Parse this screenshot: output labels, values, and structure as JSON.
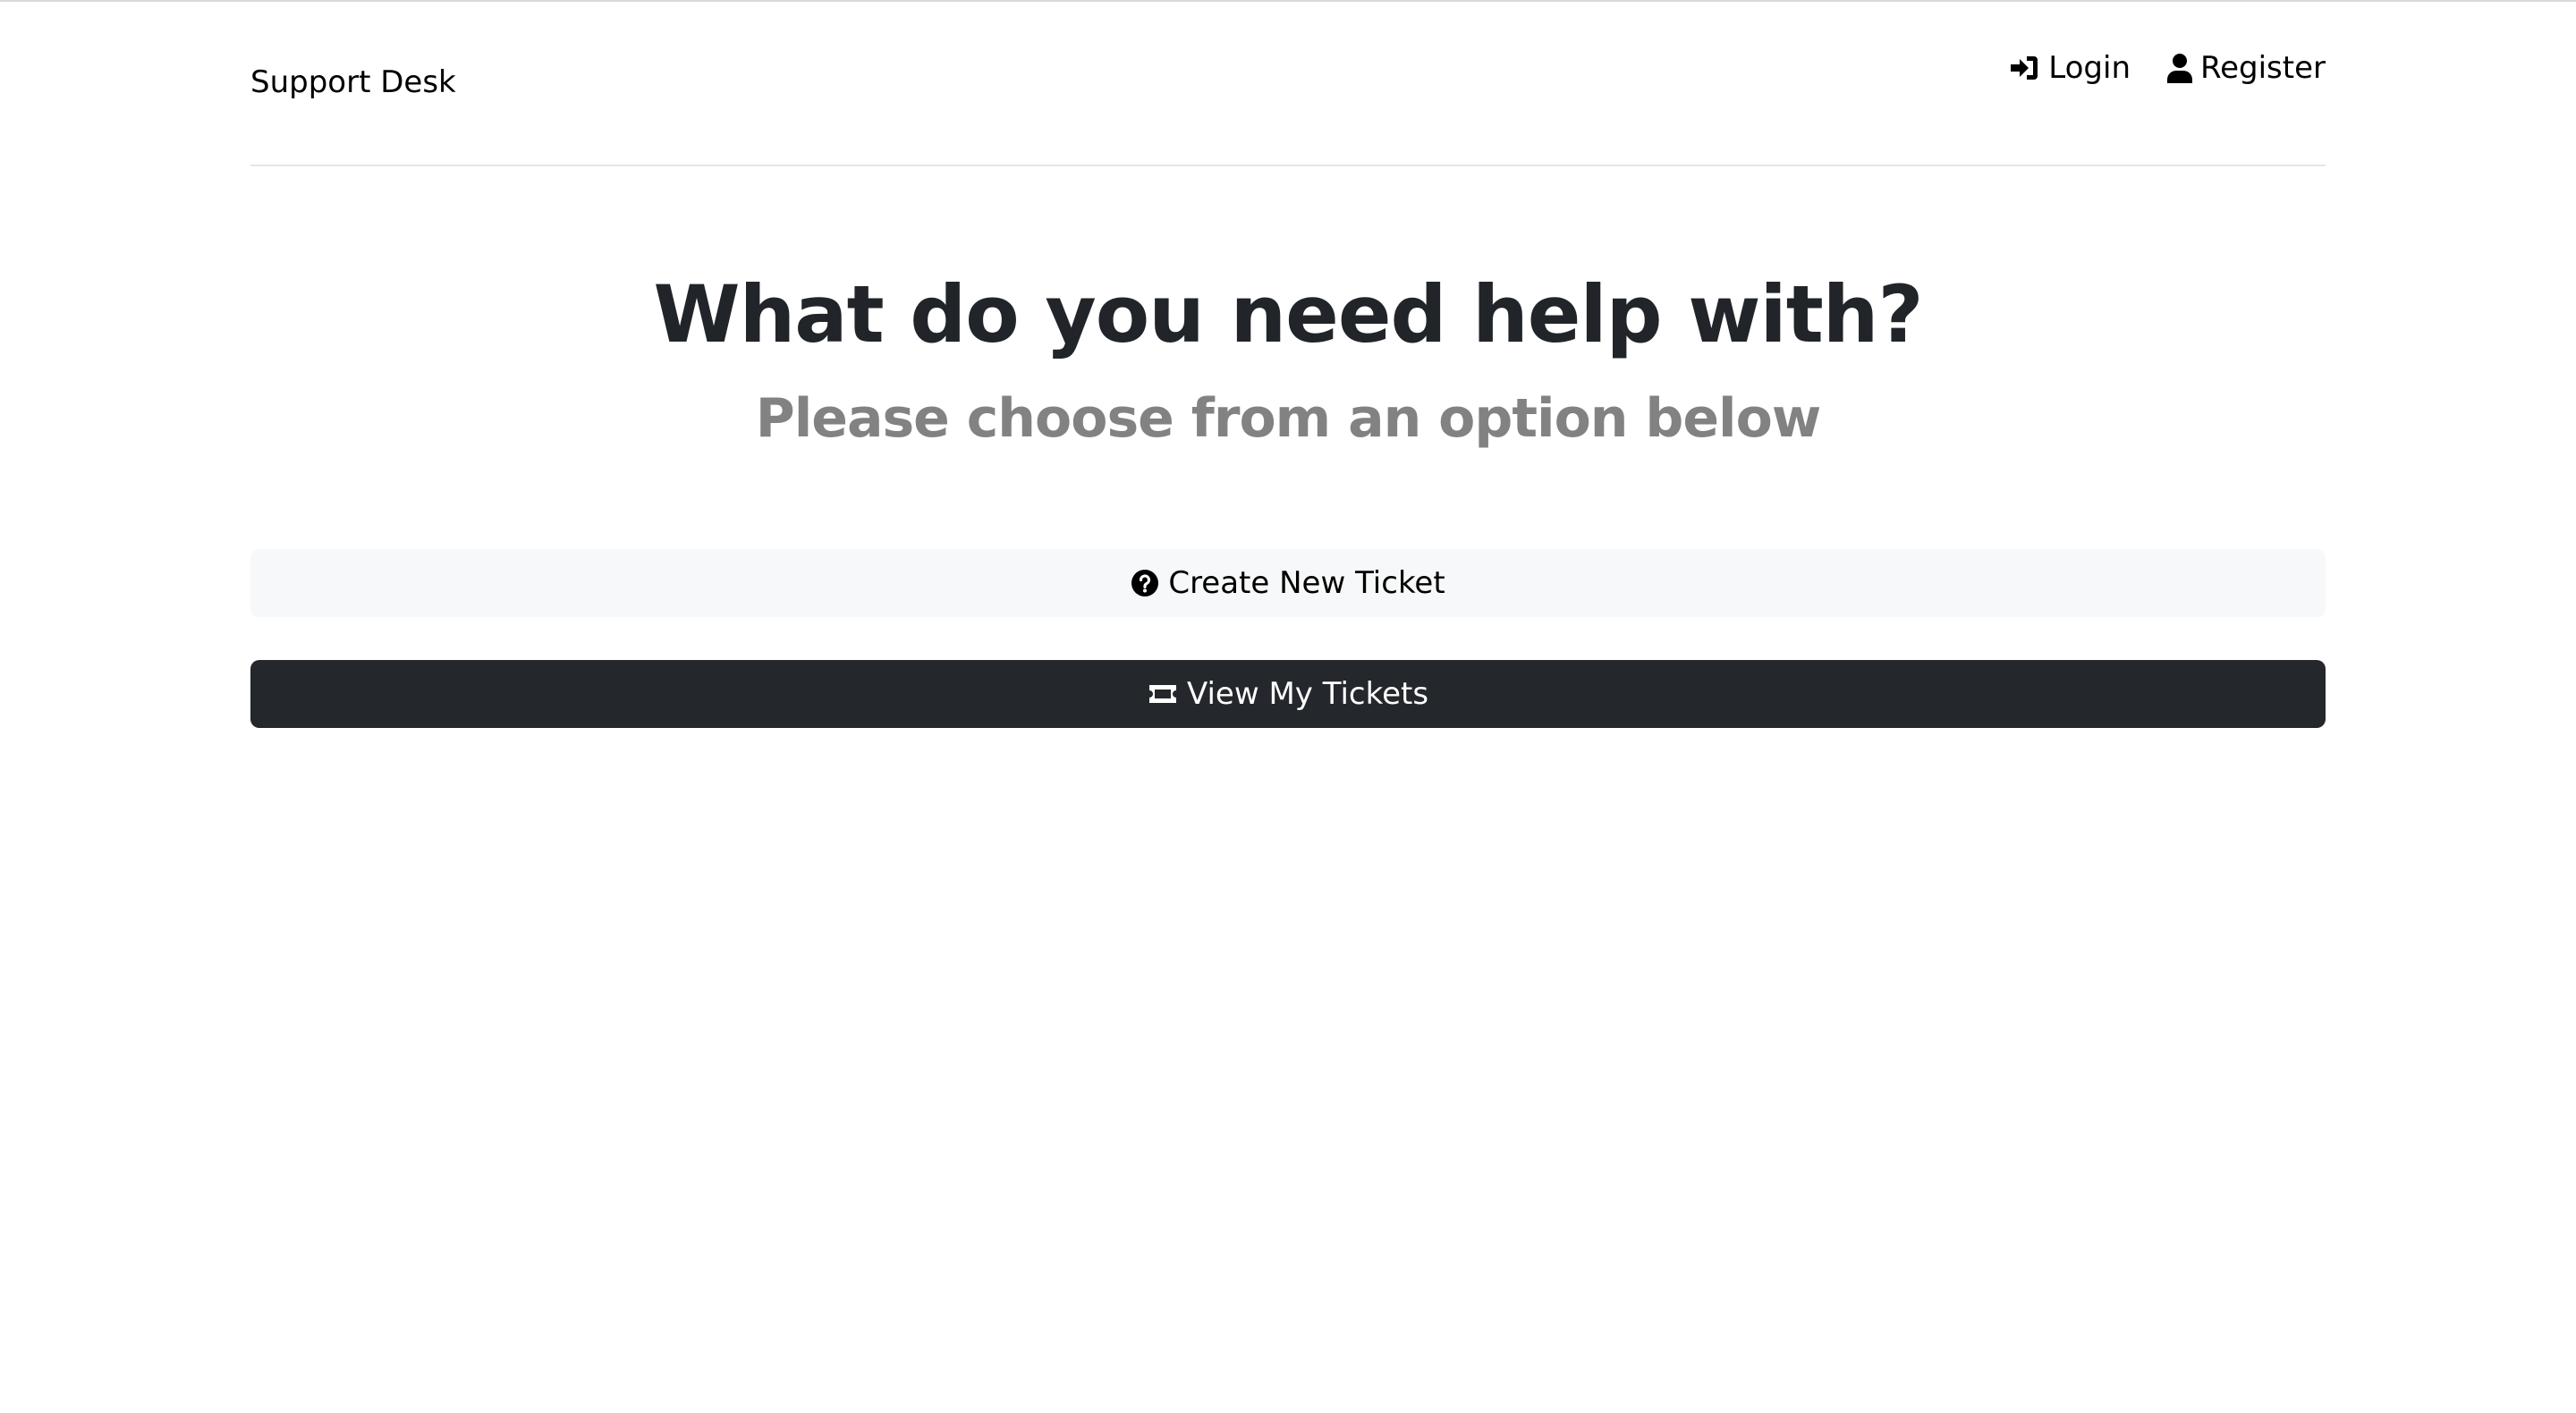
{
  "header": {
    "brand": "Support Desk",
    "nav": [
      {
        "label": "Login",
        "icon": "login-icon"
      },
      {
        "label": "Register",
        "icon": "user-icon"
      }
    ]
  },
  "hero": {
    "title": "What do you need help with?",
    "subtitle": "Please choose from an option below"
  },
  "actions": {
    "create_ticket": {
      "label": "Create New Ticket",
      "icon": "question-circle-icon"
    },
    "view_tickets": {
      "label": "View My Tickets",
      "icon": "ticket-icon"
    }
  },
  "colors": {
    "heading": "#212529",
    "subtitle": "#828282",
    "light_button_bg": "#f7f8f9",
    "dark_button_bg": "#24272b"
  }
}
